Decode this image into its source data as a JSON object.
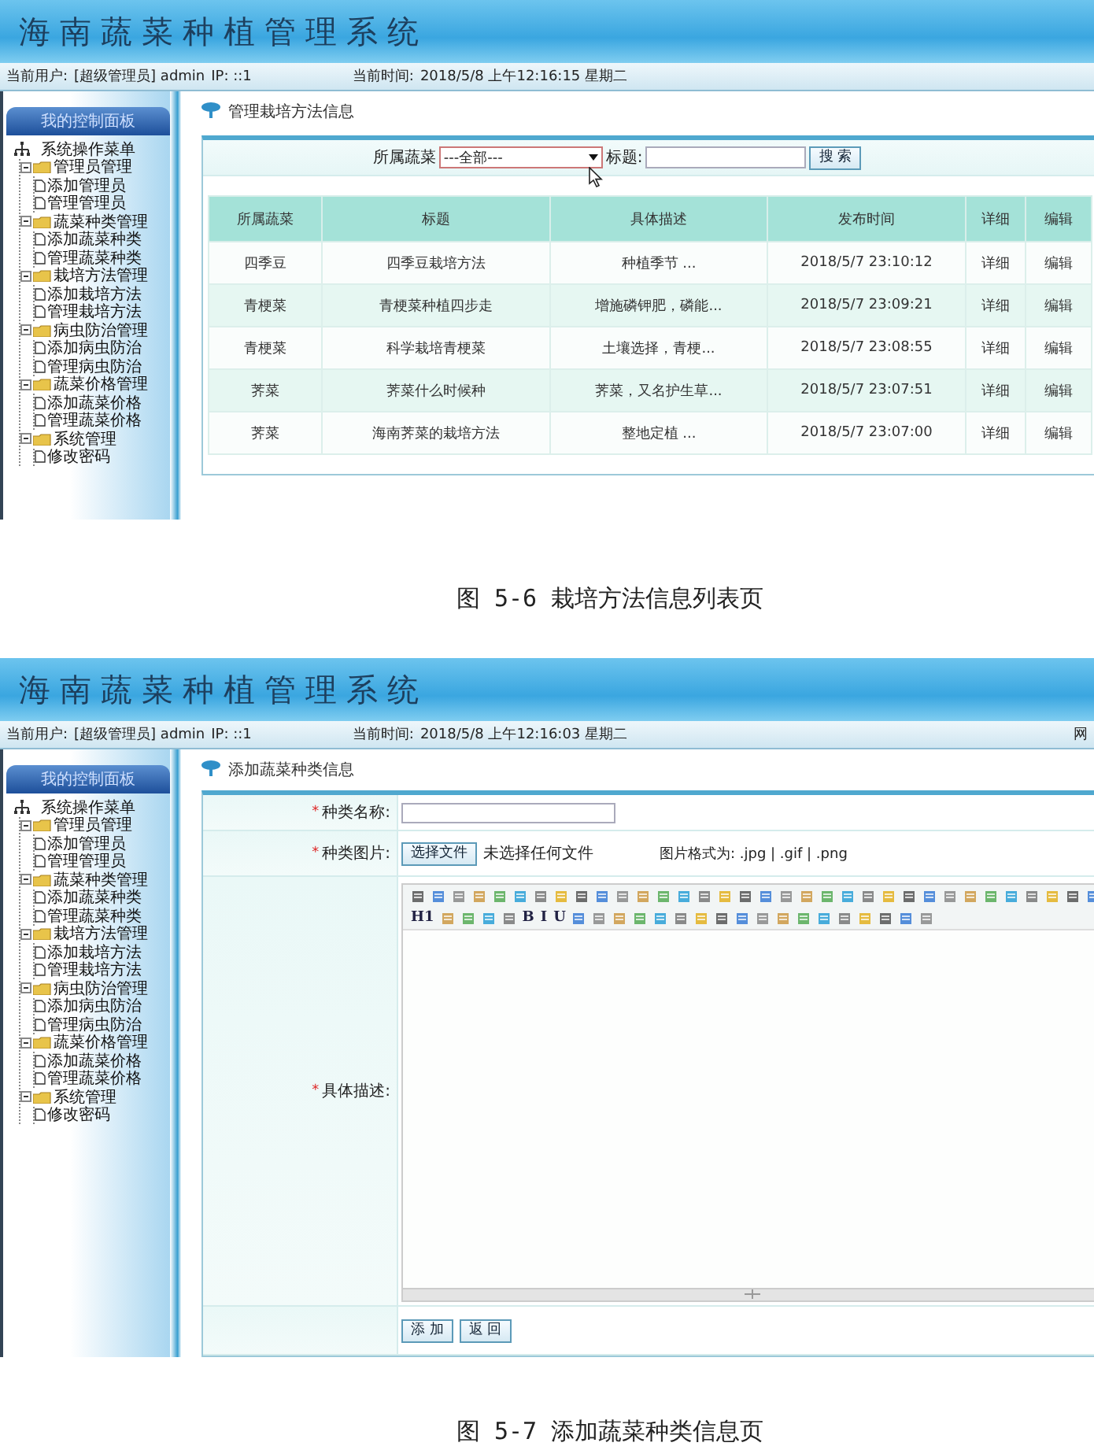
{
  "figures": [
    {
      "screen": {
        "header": {
          "title": "海南蔬菜种植管理系统"
        },
        "info_bar": {
          "user_label": "当前用户:",
          "user": "[超级管理员] admin",
          "ip": "IP: ::1",
          "time_label": "当前时间:",
          "time": "2018/5/8 上午12:16:15 星期二"
        },
        "sidebar": {
          "title": "我的控制面板",
          "menu": {
            "label": "系统操作菜单",
            "children": [
              {
                "label": "管理员管理",
                "expanded": true,
                "children": [
                  {
                    "label": "添加管理员"
                  },
                  {
                    "label": "管理管理员"
                  }
                ]
              },
              {
                "label": "蔬菜种类管理",
                "expanded": true,
                "children": [
                  {
                    "label": "添加蔬菜种类"
                  },
                  {
                    "label": "管理蔬菜种类"
                  }
                ]
              },
              {
                "label": "栽培方法管理",
                "expanded": true,
                "children": [
                  {
                    "label": "添加栽培方法"
                  },
                  {
                    "label": "管理栽培方法"
                  }
                ]
              },
              {
                "label": "病虫防治管理",
                "expanded": true,
                "children": [
                  {
                    "label": "添加病虫防治"
                  },
                  {
                    "label": "管理病虫防治"
                  }
                ]
              },
              {
                "label": "蔬菜价格管理",
                "expanded": true,
                "children": [
                  {
                    "label": "添加蔬菜价格"
                  },
                  {
                    "label": "管理蔬菜价格"
                  }
                ]
              },
              {
                "label": "系统管理",
                "expanded": true,
                "children": [
                  {
                    "label": "修改密码"
                  }
                ]
              }
            ]
          }
        },
        "page": {
          "kind": "list",
          "heading": "管理栽培方法信息",
          "filter": {
            "select_label": "所属蔬菜",
            "select_value": "---全部---",
            "title_label": "标题:",
            "button": "搜 索"
          },
          "table": {
            "columns": [
              "所属蔬菜",
              "标题",
              "具体描述",
              "发布时间",
              "详细",
              "编辑"
            ],
            "rows": [
              [
                "四季豆",
                "四季豆栽培方法",
                "种植季节 ...",
                "2018/5/7 23:10:12",
                "详细",
                "编辑"
              ],
              [
                "青梗菜",
                "青梗菜种植四步走",
                "增施磷钾肥，磷能...",
                "2018/5/7 23:09:21",
                "详细",
                "编辑"
              ],
              [
                "青梗菜",
                "科学栽培青梗菜",
                "土壤选择，青梗...",
                "2018/5/7 23:08:55",
                "详细",
                "编辑"
              ],
              [
                "荠菜",
                "荠菜什么时候种",
                "荠菜，又名护生草...",
                "2018/5/7 23:07:51",
                "详细",
                "编辑"
              ],
              [
                "荠菜",
                "海南荠菜的栽培方法",
                "整地定植 ...",
                "2018/5/7 23:07:00",
                "详细",
                "编辑"
              ]
            ]
          }
        }
      },
      "caption": "图 5-6 栽培方法信息列表页"
    },
    {
      "screen": {
        "header": {
          "title": "海南蔬菜种植管理系统"
        },
        "info_bar": {
          "user_label": "当前用户:",
          "user": "[超级管理员] admin",
          "ip": "IP: ::1",
          "time_label": "当前时间:",
          "time": "2018/5/8 上午12:16:03 星期二",
          "site_label": "网"
        },
        "sidebar": {
          "title": "我的控制面板",
          "menu": {
            "label": "系统操作菜单",
            "children": [
              {
                "label": "管理员管理",
                "expanded": true,
                "children": [
                  {
                    "label": "添加管理员"
                  },
                  {
                    "label": "管理管理员"
                  }
                ]
              },
              {
                "label": "蔬菜种类管理",
                "expanded": true,
                "children": [
                  {
                    "label": "添加蔬菜种类"
                  },
                  {
                    "label": "管理蔬菜种类"
                  }
                ]
              },
              {
                "label": "栽培方法管理",
                "expanded": true,
                "children": [
                  {
                    "label": "添加栽培方法"
                  },
                  {
                    "label": "管理栽培方法"
                  }
                ]
              },
              {
                "label": "病虫防治管理",
                "expanded": true,
                "children": [
                  {
                    "label": "添加病虫防治"
                  },
                  {
                    "label": "管理病虫防治"
                  }
                ]
              },
              {
                "label": "蔬菜价格管理",
                "expanded": true,
                "children": [
                  {
                    "label": "添加蔬菜价格"
                  },
                  {
                    "label": "管理蔬菜价格"
                  }
                ]
              },
              {
                "label": "系统管理",
                "expanded": true,
                "children": [
                  {
                    "label": "修改密码"
                  }
                ]
              }
            ]
          }
        },
        "page": {
          "kind": "form",
          "heading": "添加蔬菜种类信息",
          "fields": [
            {
              "kind": "text",
              "marker": "*",
              "label": "种类名称:"
            },
            {
              "kind": "file",
              "marker": "*",
              "label": "种类图片:",
              "button": "选择文件",
              "status": "未选择任何文件",
              "hint": "图片格式为: .jpg | .gif | .png"
            },
            {
              "kind": "editor",
              "marker": "*",
              "label": "具体描述:",
              "toolbar_text": [
                "H1",
                "B",
                "I",
                "U"
              ]
            }
          ],
          "buttons": [
            "添 加",
            "返 回"
          ]
        }
      },
      "caption": "图 5-7 添加蔬菜种类信息页"
    }
  ]
}
